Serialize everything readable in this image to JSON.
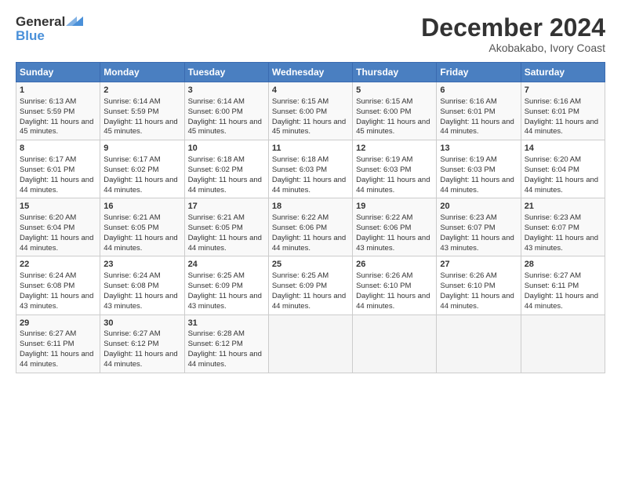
{
  "header": {
    "logo_general": "General",
    "logo_blue": "Blue",
    "month_title": "December 2024",
    "location": "Akobakabo, Ivory Coast"
  },
  "days_of_week": [
    "Sunday",
    "Monday",
    "Tuesday",
    "Wednesday",
    "Thursday",
    "Friday",
    "Saturday"
  ],
  "weeks": [
    [
      {
        "day": "1",
        "sunrise": "6:13 AM",
        "sunset": "5:59 PM",
        "daylight": "11 hours and 45 minutes."
      },
      {
        "day": "2",
        "sunrise": "6:14 AM",
        "sunset": "5:59 PM",
        "daylight": "11 hours and 45 minutes."
      },
      {
        "day": "3",
        "sunrise": "6:14 AM",
        "sunset": "6:00 PM",
        "daylight": "11 hours and 45 minutes."
      },
      {
        "day": "4",
        "sunrise": "6:15 AM",
        "sunset": "6:00 PM",
        "daylight": "11 hours and 45 minutes."
      },
      {
        "day": "5",
        "sunrise": "6:15 AM",
        "sunset": "6:00 PM",
        "daylight": "11 hours and 45 minutes."
      },
      {
        "day": "6",
        "sunrise": "6:16 AM",
        "sunset": "6:01 PM",
        "daylight": "11 hours and 44 minutes."
      },
      {
        "day": "7",
        "sunrise": "6:16 AM",
        "sunset": "6:01 PM",
        "daylight": "11 hours and 44 minutes."
      }
    ],
    [
      {
        "day": "8",
        "sunrise": "6:17 AM",
        "sunset": "6:01 PM",
        "daylight": "11 hours and 44 minutes."
      },
      {
        "day": "9",
        "sunrise": "6:17 AM",
        "sunset": "6:02 PM",
        "daylight": "11 hours and 44 minutes."
      },
      {
        "day": "10",
        "sunrise": "6:18 AM",
        "sunset": "6:02 PM",
        "daylight": "11 hours and 44 minutes."
      },
      {
        "day": "11",
        "sunrise": "6:18 AM",
        "sunset": "6:03 PM",
        "daylight": "11 hours and 44 minutes."
      },
      {
        "day": "12",
        "sunrise": "6:19 AM",
        "sunset": "6:03 PM",
        "daylight": "11 hours and 44 minutes."
      },
      {
        "day": "13",
        "sunrise": "6:19 AM",
        "sunset": "6:03 PM",
        "daylight": "11 hours and 44 minutes."
      },
      {
        "day": "14",
        "sunrise": "6:20 AM",
        "sunset": "6:04 PM",
        "daylight": "11 hours and 44 minutes."
      }
    ],
    [
      {
        "day": "15",
        "sunrise": "6:20 AM",
        "sunset": "6:04 PM",
        "daylight": "11 hours and 44 minutes."
      },
      {
        "day": "16",
        "sunrise": "6:21 AM",
        "sunset": "6:05 PM",
        "daylight": "11 hours and 44 minutes."
      },
      {
        "day": "17",
        "sunrise": "6:21 AM",
        "sunset": "6:05 PM",
        "daylight": "11 hours and 44 minutes."
      },
      {
        "day": "18",
        "sunrise": "6:22 AM",
        "sunset": "6:06 PM",
        "daylight": "11 hours and 44 minutes."
      },
      {
        "day": "19",
        "sunrise": "6:22 AM",
        "sunset": "6:06 PM",
        "daylight": "11 hours and 43 minutes."
      },
      {
        "day": "20",
        "sunrise": "6:23 AM",
        "sunset": "6:07 PM",
        "daylight": "11 hours and 43 minutes."
      },
      {
        "day": "21",
        "sunrise": "6:23 AM",
        "sunset": "6:07 PM",
        "daylight": "11 hours and 43 minutes."
      }
    ],
    [
      {
        "day": "22",
        "sunrise": "6:24 AM",
        "sunset": "6:08 PM",
        "daylight": "11 hours and 43 minutes."
      },
      {
        "day": "23",
        "sunrise": "6:24 AM",
        "sunset": "6:08 PM",
        "daylight": "11 hours and 43 minutes."
      },
      {
        "day": "24",
        "sunrise": "6:25 AM",
        "sunset": "6:09 PM",
        "daylight": "11 hours and 43 minutes."
      },
      {
        "day": "25",
        "sunrise": "6:25 AM",
        "sunset": "6:09 PM",
        "daylight": "11 hours and 44 minutes."
      },
      {
        "day": "26",
        "sunrise": "6:26 AM",
        "sunset": "6:10 PM",
        "daylight": "11 hours and 44 minutes."
      },
      {
        "day": "27",
        "sunrise": "6:26 AM",
        "sunset": "6:10 PM",
        "daylight": "11 hours and 44 minutes."
      },
      {
        "day": "28",
        "sunrise": "6:27 AM",
        "sunset": "6:11 PM",
        "daylight": "11 hours and 44 minutes."
      }
    ],
    [
      {
        "day": "29",
        "sunrise": "6:27 AM",
        "sunset": "6:11 PM",
        "daylight": "11 hours and 44 minutes."
      },
      {
        "day": "30",
        "sunrise": "6:27 AM",
        "sunset": "6:12 PM",
        "daylight": "11 hours and 44 minutes."
      },
      {
        "day": "31",
        "sunrise": "6:28 AM",
        "sunset": "6:12 PM",
        "daylight": "11 hours and 44 minutes."
      },
      null,
      null,
      null,
      null
    ]
  ]
}
